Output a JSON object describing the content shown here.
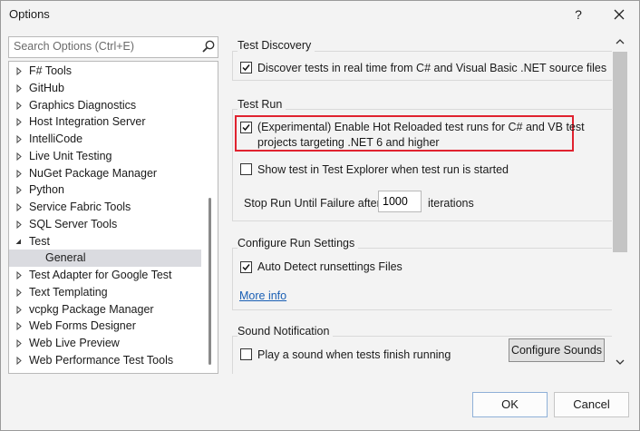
{
  "window": {
    "title": "Options",
    "help_glyph": "?"
  },
  "search": {
    "placeholder": "Search Options (Ctrl+E)"
  },
  "tree": {
    "items": [
      {
        "label": "F# Tools",
        "state": "collapsed"
      },
      {
        "label": "GitHub",
        "state": "collapsed"
      },
      {
        "label": "Graphics Diagnostics",
        "state": "collapsed"
      },
      {
        "label": "Host Integration Server",
        "state": "collapsed"
      },
      {
        "label": "IntelliCode",
        "state": "collapsed"
      },
      {
        "label": "Live Unit Testing",
        "state": "collapsed"
      },
      {
        "label": "NuGet Package Manager",
        "state": "collapsed"
      },
      {
        "label": "Python",
        "state": "collapsed"
      },
      {
        "label": "Service Fabric Tools",
        "state": "collapsed"
      },
      {
        "label": "SQL Server Tools",
        "state": "collapsed"
      },
      {
        "label": "Test",
        "state": "expanded"
      },
      {
        "label": "General",
        "state": "child-selected"
      },
      {
        "label": "Test Adapter for Google Test",
        "state": "collapsed"
      },
      {
        "label": "Text Templating",
        "state": "collapsed"
      },
      {
        "label": "vcpkg Package Manager",
        "state": "collapsed"
      },
      {
        "label": "Web Forms Designer",
        "state": "collapsed"
      },
      {
        "label": "Web Live Preview",
        "state": "collapsed"
      },
      {
        "label": "Web Performance Test Tools",
        "state": "collapsed"
      }
    ]
  },
  "sections": {
    "test_discovery": {
      "title": "Test Discovery",
      "discover_label": "Discover tests in real time from C# and Visual Basic .NET source files",
      "discover_checked": true
    },
    "test_run": {
      "title": "Test Run",
      "hot_reload_line1": "(Experimental) Enable Hot Reloaded test runs for C# and VB test",
      "hot_reload_line2": "projects targeting .NET 6 and higher",
      "hot_reload_checked": true,
      "show_explorer_label": "Show test in Test Explorer when test run is started",
      "show_explorer_checked": false,
      "stop_run_label": "Stop Run Until Failure after",
      "stop_run_value": "1000",
      "iterations_label": "iterations"
    },
    "run_settings": {
      "title": "Configure Run Settings",
      "auto_detect_label": "Auto Detect runsettings Files",
      "auto_detect_checked": true,
      "more_info": "More info"
    },
    "sound": {
      "title": "Sound Notification",
      "play_sound_label": "Play a sound when tests finish running",
      "play_sound_checked": false,
      "configure_sounds": "Configure Sounds"
    }
  },
  "buttons": {
    "ok": "OK",
    "cancel": "Cancel"
  },
  "colors": {
    "highlight_border": "#e0222f",
    "link": "#1a5fb4",
    "selected_item": "#dadbe0"
  }
}
